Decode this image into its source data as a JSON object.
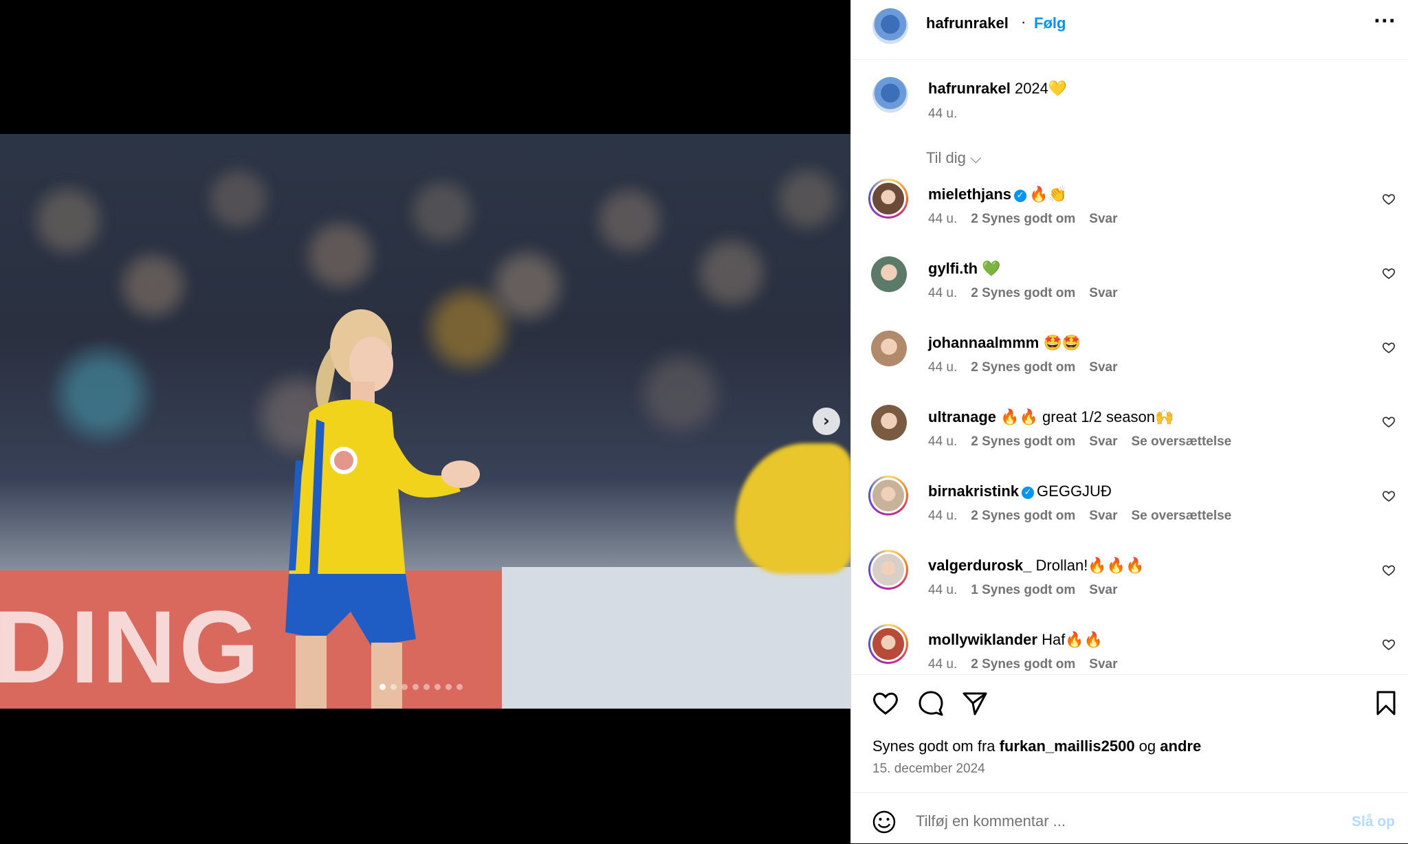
{
  "post": {
    "username": "hafrunrakel",
    "separator": "·",
    "follow_label": "Følg",
    "more_label": "···",
    "caption_text": "2024💛",
    "caption_time": "44 u.",
    "filter_label": "Til dig ⌵",
    "carousel_count": 8,
    "carousel_active": 1,
    "next_label": "›"
  },
  "comments": [
    {
      "username": "mielethjans",
      "verified": true,
      "text": "🔥👏",
      "time": "44 u.",
      "likes": "2 Synes godt om",
      "reply": "Svar",
      "translate": "",
      "ring": true
    },
    {
      "username": "gylfi.th",
      "verified": false,
      "text": "💚",
      "time": "44 u.",
      "likes": "2 Synes godt om",
      "reply": "Svar",
      "translate": "",
      "ring": false
    },
    {
      "username": "johannaalmmm",
      "verified": false,
      "text": "🤩🤩",
      "time": "44 u.",
      "likes": "2 Synes godt om",
      "reply": "Svar",
      "translate": "",
      "ring": false
    },
    {
      "username": "ultranage",
      "verified": false,
      "text": "🔥🔥 great 1/2 season🙌",
      "time": "44 u.",
      "likes": "2 Synes godt om",
      "reply": "Svar",
      "translate": "Se oversættelse",
      "ring": false
    },
    {
      "username": "birnakristink",
      "verified": true,
      "text": "GEGGJUÐ",
      "time": "44 u.",
      "likes": "2 Synes godt om",
      "reply": "Svar",
      "translate": "Se oversættelse",
      "ring": true
    },
    {
      "username": "valgerdurosk_",
      "verified": false,
      "text": "Drollan!🔥🔥🔥",
      "time": "44 u.",
      "likes": "1 Synes godt om",
      "reply": "Svar",
      "translate": "",
      "ring": true
    },
    {
      "username": "mollywiklander",
      "verified": false,
      "text": "Haf🔥🔥",
      "time": "44 u.",
      "likes": "2 Synes godt om",
      "reply": "Svar",
      "translate": "",
      "ring": true
    }
  ],
  "footer": {
    "likes_prefix": "Synes godt om fra ",
    "likes_user": "furkan_maillis2500",
    "likes_mid": " og ",
    "likes_suffix": "andre",
    "date": "15. december 2024",
    "comment_placeholder": "Tilføj en kommentar ...",
    "post_label": "Slå op"
  },
  "colors": {
    "accent": "#0095f6",
    "jersey_yellow": "#f2d31b",
    "shorts_blue": "#1f5cc4",
    "banner_red": "#d9695d"
  }
}
